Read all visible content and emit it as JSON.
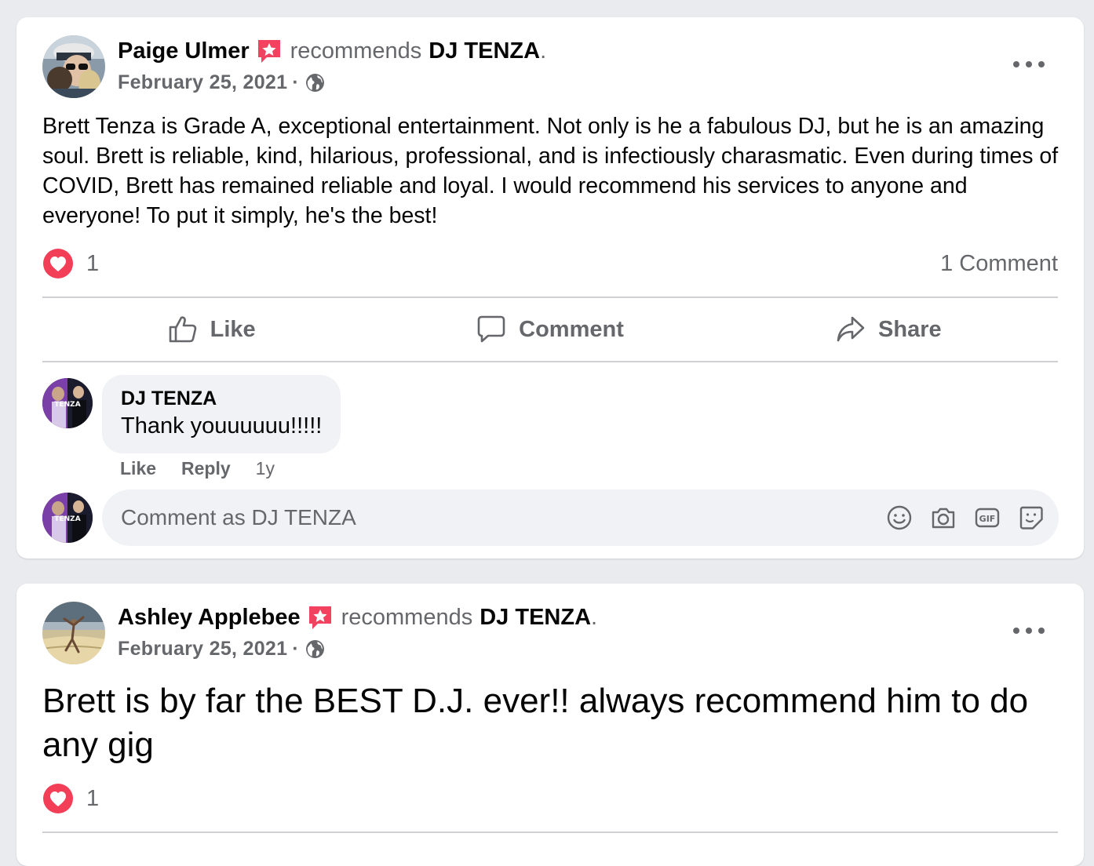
{
  "posts": [
    {
      "author": "Paige Ulmer",
      "verb": "recommends",
      "page": "DJ TENZA",
      "date": "February 25, 2021",
      "date_sep": "·",
      "text": "Brett Tenza is Grade A, exceptional entertainment. Not only is he a fabulous DJ, but he is an amazing soul. Brett is reliable, kind, hilarious, professional, and is infectiously charasmatic. Even during times of COVID, Brett has remained reliable and loyal. I would recommend his services to anyone and everyone! To put it simply, he's the best!",
      "reaction_count": "1",
      "comment_count": "1 Comment",
      "actions": {
        "like": "Like",
        "comment": "Comment",
        "share": "Share"
      },
      "comments": [
        {
          "author": "DJ TENZA",
          "text": "Thank youuuuuu!!!!!",
          "like_label": "Like",
          "reply_label": "Reply",
          "age": "1y"
        }
      ],
      "composer": {
        "placeholder": "Comment as DJ TENZA"
      }
    },
    {
      "author": "Ashley Applebee",
      "verb": "recommends",
      "page": "DJ TENZA",
      "date": "February 25, 2021",
      "date_sep": "·",
      "text": "Brett is by far the BEST D.J. ever!! always recommend him to do any gig",
      "reaction_count": "1"
    }
  ],
  "icons": {
    "recommend": "recommend-badge-icon",
    "privacy": "globe-icon",
    "reaction": "heart-reaction-icon",
    "like": "thumbs-up-icon",
    "comment": "speech-bubble-icon",
    "share": "share-arrow-icon",
    "more": "more-options-icon",
    "emoji": "smiley-icon",
    "camera": "camera-icon",
    "gif": "gif-icon",
    "sticker": "sticker-icon"
  },
  "colors": {
    "background": "#e9ebee",
    "card": "#ffffff",
    "text_primary": "#050505",
    "text_secondary": "#65676b",
    "bubble": "#f0f2f5",
    "recommend_badge": "#f3425f",
    "heart": "#f33e58"
  }
}
